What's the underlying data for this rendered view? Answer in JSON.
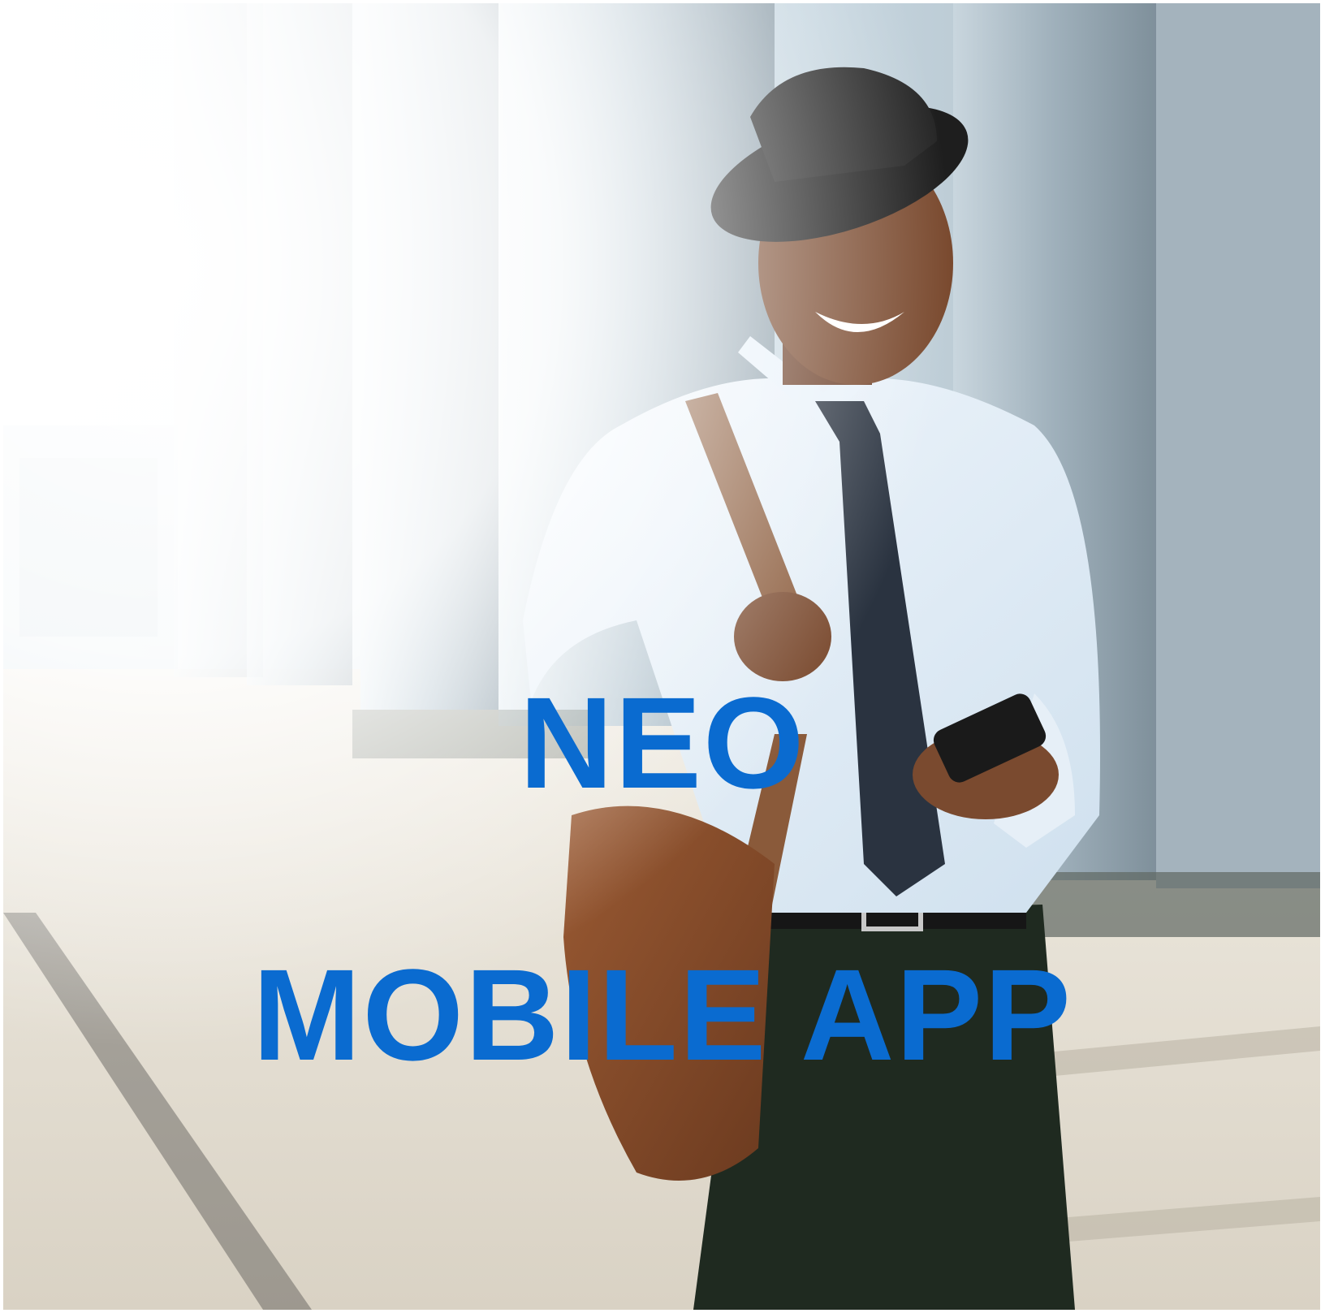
{
  "headline": {
    "line1": "NEO",
    "line2": "MOBILE APP"
  },
  "colors": {
    "headline_text": "#0a6bd0",
    "frame_border": "#ffffff"
  },
  "photo": {
    "subject": "smiling-man-using-phone"
  }
}
